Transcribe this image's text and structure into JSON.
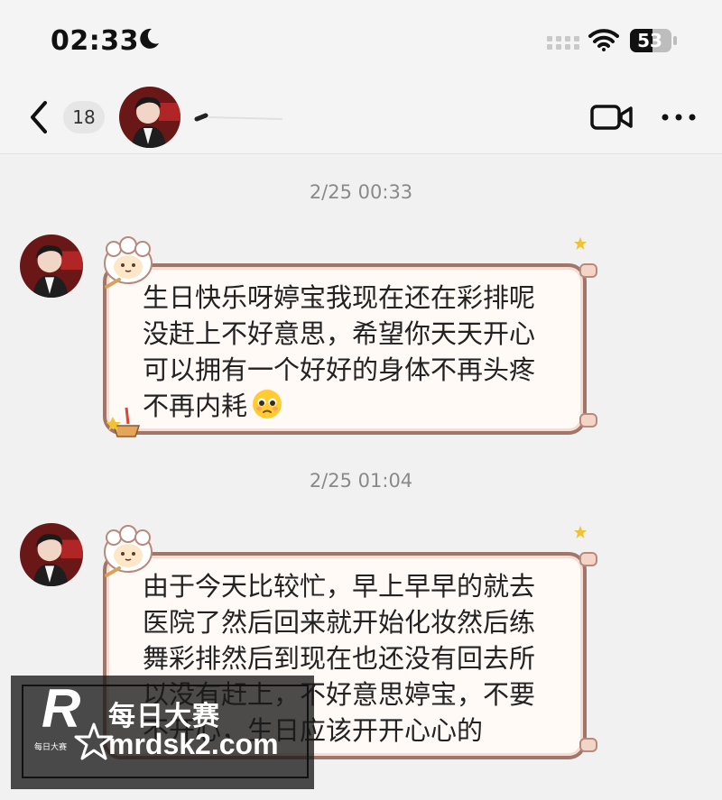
{
  "status_bar": {
    "time": "02:33",
    "battery": "53"
  },
  "nav_bar": {
    "unread_count": "18",
    "icons": [
      "back-icon",
      "video-call-icon",
      "more-icon"
    ]
  },
  "messages": [
    {
      "timestamp": "2/25 00:33",
      "lines": [
        "生日快乐呀婷宝我现在还在彩排呢",
        "没赶上不好意思，希望你天天开心",
        "可以拥有一个好好的身体不再头疼",
        "不再内耗"
      ],
      "trailing_emoji": "pleading-face"
    },
    {
      "timestamp": "2/25 01:04",
      "lines": [
        "由于今天比较忙，早上早早的就去",
        "医院了然后回来就开始化妆然后练",
        "舞彩排然后到现在也还没有回去所",
        "以没有赶上，不好意思婷宝，不要",
        "不开心，生日应该开开心心的"
      ]
    }
  ],
  "watermark": {
    "logo_letter": "R",
    "logo_small": "每日大赛",
    "brand": "每日大赛",
    "url": "mrdsk2.com"
  },
  "colors": {
    "background": "#f1f1f1",
    "bubble_fill": "#fffaf6",
    "bubble_border": "#a1756a",
    "timestamp": "#8a8a8a"
  }
}
